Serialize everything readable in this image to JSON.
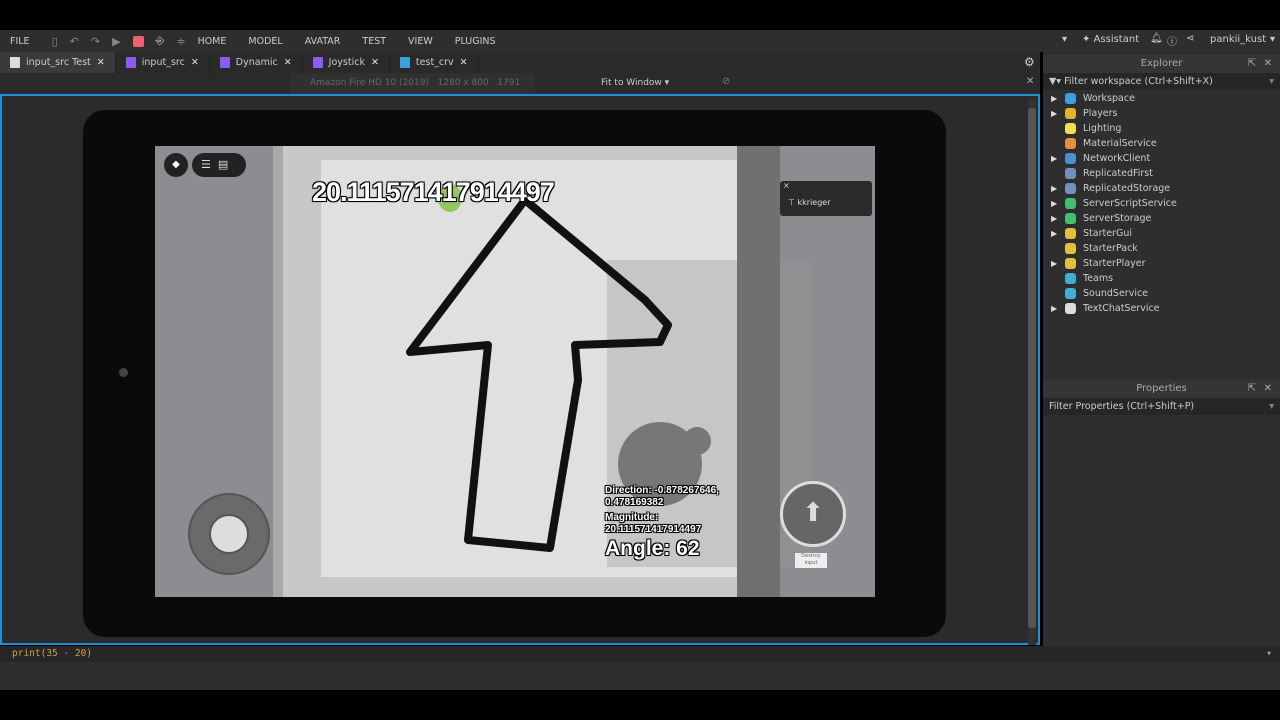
{
  "menubar": {
    "file": "FILE",
    "items": [
      "HOME",
      "MODEL",
      "AVATAR",
      "TEST",
      "VIEW",
      "PLUGINS"
    ],
    "assistant": "Assistant",
    "user": "pankii_kust"
  },
  "tabs": [
    {
      "label": "input_src Test",
      "color": "#dddddd"
    },
    {
      "label": "input_src",
      "color": "#8a5cf0"
    },
    {
      "label": "Dynamic",
      "color": "#8a5cf0"
    },
    {
      "label": "Joystick",
      "color": "#8a5cf0"
    },
    {
      "label": "test_crv",
      "color": "#3aa0e0"
    }
  ],
  "device": {
    "name": "Amazon Fire HD 10 (2019)",
    "resolution": "1280 x 800",
    "memory": "1791 MB",
    "zoom": "Fit to Window"
  },
  "game": {
    "magnitude_big": "20.111571417914497",
    "direction": "Direction: -0.878267646,",
    "direction2": "0.478169382",
    "magnitude_label": "Magnitude:",
    "magnitude": "20.111571417914497",
    "angle": "Angle: 62",
    "player": "kkrieger",
    "destroy": "Destroy input"
  },
  "explorer": {
    "title": "Explorer",
    "filter": "Filter workspace (Ctrl+Shift+X)",
    "items": [
      {
        "label": "Workspace",
        "expand": true,
        "color": "#3aa0e0"
      },
      {
        "label": "Players",
        "expand": true,
        "color": "#e0b030"
      },
      {
        "label": "Lighting",
        "expand": false,
        "color": "#f0e050"
      },
      {
        "label": "MaterialService",
        "expand": false,
        "color": "#e09040"
      },
      {
        "label": "NetworkClient",
        "expand": true,
        "color": "#4a90d0"
      },
      {
        "label": "ReplicatedFirst",
        "expand": false,
        "color": "#7090c0"
      },
      {
        "label": "ReplicatedStorage",
        "expand": true,
        "color": "#7090c0"
      },
      {
        "label": "ServerScriptService",
        "expand": true,
        "color": "#40c070"
      },
      {
        "label": "ServerStorage",
        "expand": true,
        "color": "#40c070"
      },
      {
        "label": "StarterGui",
        "expand": true,
        "color": "#e0c040"
      },
      {
        "label": "StarterPack",
        "expand": false,
        "color": "#e0c040"
      },
      {
        "label": "StarterPlayer",
        "expand": true,
        "color": "#e0c040"
      },
      {
        "label": "Teams",
        "expand": false,
        "color": "#40b0d0"
      },
      {
        "label": "SoundService",
        "expand": false,
        "color": "#40b0d0"
      },
      {
        "label": "TextChatService",
        "expand": true,
        "color": "#dddddd"
      }
    ]
  },
  "properties": {
    "title": "Properties",
    "filter": "Filter Properties (Ctrl+Shift+P)"
  },
  "command": "print(35 - 20)"
}
